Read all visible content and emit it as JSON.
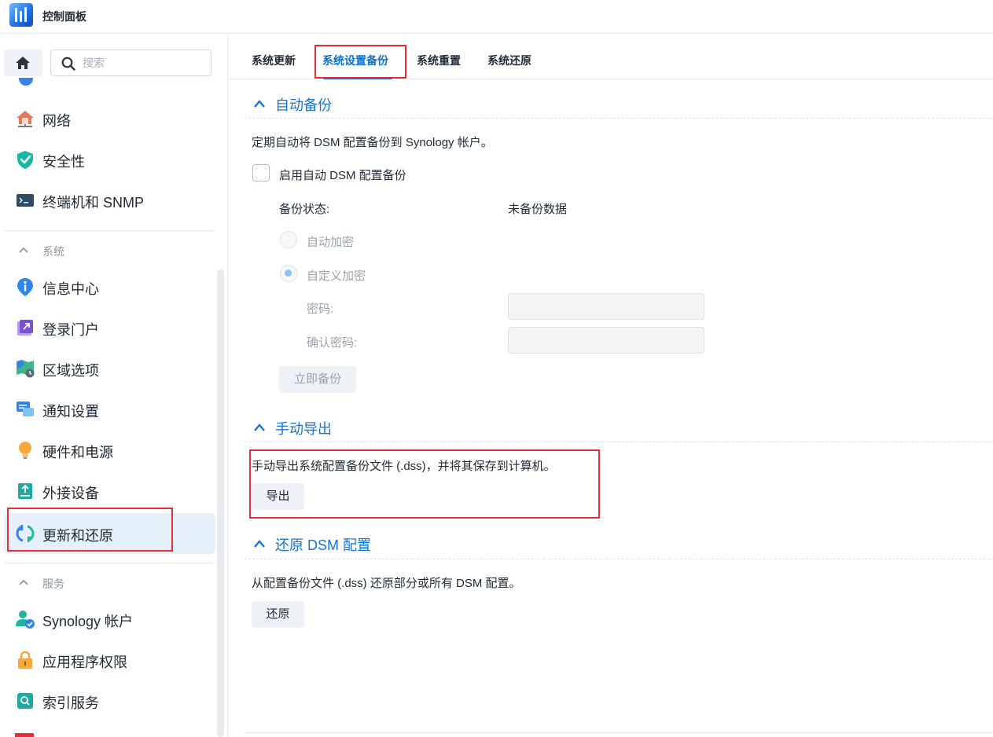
{
  "window": {
    "title": "控制面板"
  },
  "search": {
    "placeholder": "搜索"
  },
  "sidebar": {
    "top_items": [
      {
        "label": "网络",
        "icon": "network-house-icon"
      },
      {
        "label": "安全性",
        "icon": "shield-check-icon"
      },
      {
        "label": "终端机和 SNMP",
        "icon": "terminal-icon"
      }
    ],
    "section_system": "系统",
    "system_items": [
      {
        "label": "信息中心",
        "icon": "info-icon"
      },
      {
        "label": "登录门户",
        "icon": "login-portal-icon"
      },
      {
        "label": "区域选项",
        "icon": "regional-map-icon"
      },
      {
        "label": "通知设置",
        "icon": "notification-chat-icon"
      },
      {
        "label": "硬件和电源",
        "icon": "lightbulb-icon"
      },
      {
        "label": "外接设备",
        "icon": "external-device-icon"
      },
      {
        "label": "更新和还原",
        "icon": "update-restore-icon",
        "active": true
      }
    ],
    "section_services": "服务",
    "service_items": [
      {
        "label": "Synology 帐户",
        "icon": "synology-account-icon"
      },
      {
        "label": "应用程序权限",
        "icon": "lock-icon"
      },
      {
        "label": "索引服务",
        "icon": "index-search-icon"
      }
    ]
  },
  "tabs": [
    {
      "label": "系统更新"
    },
    {
      "label": "系统设置备份",
      "active": true
    },
    {
      "label": "系统重置"
    },
    {
      "label": "系统还原"
    }
  ],
  "auto_backup": {
    "title": "自动备份",
    "description": "定期自动将 DSM 配置备份到 Synology 帐户。",
    "enable_label": "启用自动 DSM 配置备份",
    "enabled": false,
    "status_label": "备份状态:",
    "status_value": "未备份数据",
    "radio_auto": "自动加密",
    "radio_custom": "自定义加密",
    "password_label": "密码:",
    "confirm_password_label": "确认密码:",
    "backup_now_button": "立即备份"
  },
  "manual_export": {
    "title": "手动导出",
    "description": "手动导出系统配置备份文件 (.dss)，并将其保存到计算机。",
    "export_button": "导出"
  },
  "restore": {
    "title": "还原 DSM 配置",
    "description": "从配置备份文件 (.dss) 还原部分或所有 DSM 配置。",
    "restore_button": "还原"
  },
  "colors": {
    "accent": "#0a72cc",
    "section_title": "#1a74c9",
    "highlight": "#e0313b",
    "active_bg": "#e6f0fb"
  }
}
